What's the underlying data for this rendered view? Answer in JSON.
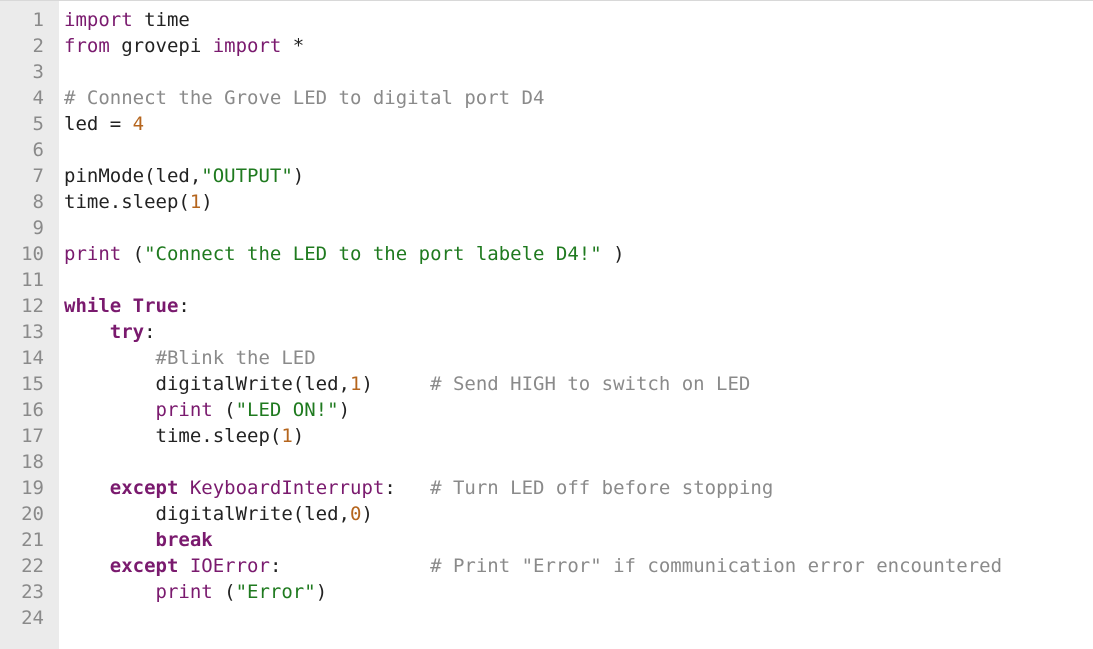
{
  "editor": {
    "lines": [
      {
        "n": "1",
        "tokens": [
          {
            "t": "import",
            "c": "kw"
          },
          {
            "t": " time",
            "c": ""
          }
        ]
      },
      {
        "n": "2",
        "tokens": [
          {
            "t": "from",
            "c": "kw"
          },
          {
            "t": " grovepi ",
            "c": ""
          },
          {
            "t": "import",
            "c": "kw"
          },
          {
            "t": " *",
            "c": ""
          }
        ]
      },
      {
        "n": "3",
        "tokens": []
      },
      {
        "n": "4",
        "tokens": [
          {
            "t": "# Connect the Grove LED to digital port D4",
            "c": "cmt"
          }
        ]
      },
      {
        "n": "5",
        "tokens": [
          {
            "t": "led = ",
            "c": ""
          },
          {
            "t": "4",
            "c": "num"
          }
        ]
      },
      {
        "n": "6",
        "tokens": []
      },
      {
        "n": "7",
        "tokens": [
          {
            "t": "pinMode(led,",
            "c": ""
          },
          {
            "t": "\"OUTPUT\"",
            "c": "str"
          },
          {
            "t": ")",
            "c": ""
          }
        ]
      },
      {
        "n": "8",
        "tokens": [
          {
            "t": "time.sleep(",
            "c": ""
          },
          {
            "t": "1",
            "c": "num"
          },
          {
            "t": ")",
            "c": ""
          }
        ]
      },
      {
        "n": "9",
        "tokens": []
      },
      {
        "n": "10",
        "tokens": [
          {
            "t": "print",
            "c": "kw"
          },
          {
            "t": " (",
            "c": ""
          },
          {
            "t": "\"Connect the LED to the port labele D4!\"",
            "c": "str"
          },
          {
            "t": " )",
            "c": ""
          }
        ]
      },
      {
        "n": "11",
        "tokens": []
      },
      {
        "n": "12",
        "tokens": [
          {
            "t": "while",
            "c": "kwb"
          },
          {
            "t": " ",
            "c": ""
          },
          {
            "t": "True",
            "c": "kwb"
          },
          {
            "t": ":",
            "c": ""
          }
        ]
      },
      {
        "n": "13",
        "tokens": [
          {
            "t": "    ",
            "c": ""
          },
          {
            "t": "try",
            "c": "kwb"
          },
          {
            "t": ":",
            "c": ""
          }
        ]
      },
      {
        "n": "14",
        "tokens": [
          {
            "t": "        ",
            "c": ""
          },
          {
            "t": "#Blink the LED",
            "c": "cmt"
          }
        ]
      },
      {
        "n": "15",
        "tokens": [
          {
            "t": "        digitalWrite(led,",
            "c": ""
          },
          {
            "t": "1",
            "c": "num"
          },
          {
            "t": ")     ",
            "c": ""
          },
          {
            "t": "# Send HIGH to switch on LED",
            "c": "cmt"
          }
        ]
      },
      {
        "n": "16",
        "tokens": [
          {
            "t": "        ",
            "c": ""
          },
          {
            "t": "print",
            "c": "kw"
          },
          {
            "t": " (",
            "c": ""
          },
          {
            "t": "\"LED ON!\"",
            "c": "str"
          },
          {
            "t": ")",
            "c": ""
          }
        ]
      },
      {
        "n": "17",
        "tokens": [
          {
            "t": "        time.sleep(",
            "c": ""
          },
          {
            "t": "1",
            "c": "num"
          },
          {
            "t": ")",
            "c": ""
          }
        ]
      },
      {
        "n": "18",
        "tokens": []
      },
      {
        "n": "19",
        "tokens": [
          {
            "t": "    ",
            "c": ""
          },
          {
            "t": "except",
            "c": "kwb"
          },
          {
            "t": " ",
            "c": ""
          },
          {
            "t": "KeyboardInterrupt",
            "c": "cls"
          },
          {
            "t": ":   ",
            "c": ""
          },
          {
            "t": "# Turn LED off before stopping",
            "c": "cmt"
          }
        ]
      },
      {
        "n": "20",
        "tokens": [
          {
            "t": "        digitalWrite(led,",
            "c": ""
          },
          {
            "t": "0",
            "c": "num"
          },
          {
            "t": ")",
            "c": ""
          }
        ]
      },
      {
        "n": "21",
        "tokens": [
          {
            "t": "        ",
            "c": ""
          },
          {
            "t": "break",
            "c": "kwb"
          }
        ]
      },
      {
        "n": "22",
        "tokens": [
          {
            "t": "    ",
            "c": ""
          },
          {
            "t": "except",
            "c": "kwb"
          },
          {
            "t": " ",
            "c": ""
          },
          {
            "t": "IOError",
            "c": "cls"
          },
          {
            "t": ":             ",
            "c": ""
          },
          {
            "t": "# Print \"Error\" if communication error encountered",
            "c": "cmt"
          }
        ]
      },
      {
        "n": "23",
        "tokens": [
          {
            "t": "        ",
            "c": ""
          },
          {
            "t": "print",
            "c": "kw"
          },
          {
            "t": " (",
            "c": ""
          },
          {
            "t": "\"Error\"",
            "c": "str"
          },
          {
            "t": ")",
            "c": ""
          }
        ]
      },
      {
        "n": "24",
        "tokens": []
      }
    ]
  }
}
